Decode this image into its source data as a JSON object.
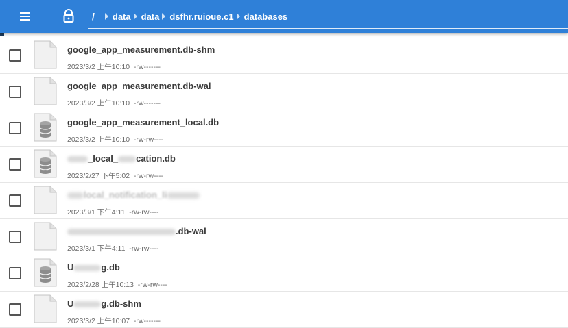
{
  "header": {
    "root": "/",
    "crumbs": [
      "data",
      "data",
      "dsfhr.ruioue.c1",
      "databases"
    ]
  },
  "files": [
    {
      "name": "google_app_measurement.db-shm",
      "date": "2023/3/2 上午10:10",
      "perms": "-rw-------",
      "icon": "file-icon"
    },
    {
      "name": "google_app_measurement.db-wal",
      "date": "2023/3/2 上午10:10",
      "perms": "-rw-------",
      "icon": "file-icon"
    },
    {
      "name": "google_app_measurement_local.db",
      "date": "2023/3/2 上午10:10",
      "perms": "-rw-rw----",
      "icon": "database-icon"
    },
    {
      "name_parts": [
        "_local_",
        "cation.db"
      ],
      "date": "2023/2/27 下午5:02",
      "perms": "-rw-rw----",
      "icon": "database-icon"
    },
    {
      "name_parts": [
        "local_notification_li"
      ],
      "date": "2023/3/1 下午4:11",
      "perms": "-rw-rw----",
      "icon": "file-icon"
    },
    {
      "name_parts": [
        ".db-wal"
      ],
      "date": "2023/3/1 下午4:11",
      "perms": "-rw-rw----",
      "icon": "file-icon"
    },
    {
      "name_parts": [
        "U",
        "g.db"
      ],
      "date": "2023/2/28 上午10:13",
      "perms": "-rw-rw----",
      "icon": "database-icon"
    },
    {
      "name_parts": [
        "U",
        "g.db-shm"
      ],
      "date": "2023/3/2 上午10:07",
      "perms": "-rw-------",
      "icon": "file-icon"
    }
  ]
}
